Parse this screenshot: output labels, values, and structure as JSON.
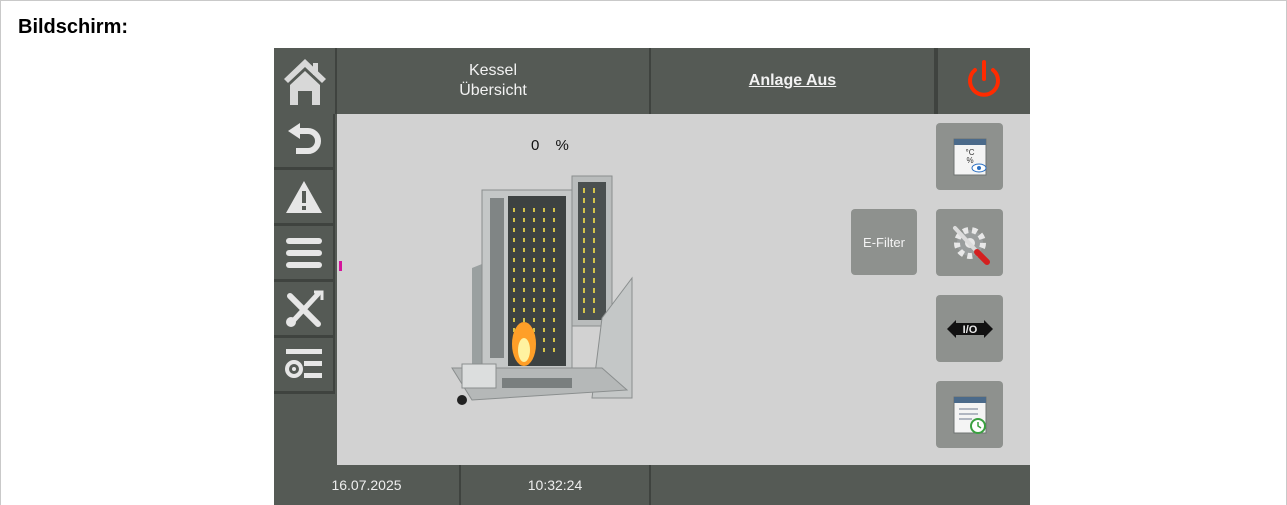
{
  "document": {
    "title": "Bildschirm:"
  },
  "header": {
    "title_line1": "Kessel",
    "title_line2": "Übersicht",
    "status": "Anlage Aus",
    "power_color": "#ff2b00"
  },
  "sidebar": {
    "items": [
      {
        "icon": "home-icon"
      },
      {
        "icon": "back-arrow-icon"
      },
      {
        "icon": "warning-icon"
      },
      {
        "icon": "menu-icon"
      },
      {
        "icon": "tools-icon"
      },
      {
        "icon": "settings-list-icon"
      }
    ]
  },
  "main": {
    "percent_value": "0",
    "percent_unit": "%",
    "efilter_label": "E-Filter",
    "right_buttons": [
      {
        "icon": "temperature-view-icon"
      },
      {
        "icon": "service-settings-icon"
      },
      {
        "icon": "io-arrows-icon",
        "label": "I/O"
      },
      {
        "icon": "schedule-icon"
      }
    ]
  },
  "footer": {
    "date": "16.07.2025",
    "time": "10:32:24"
  }
}
